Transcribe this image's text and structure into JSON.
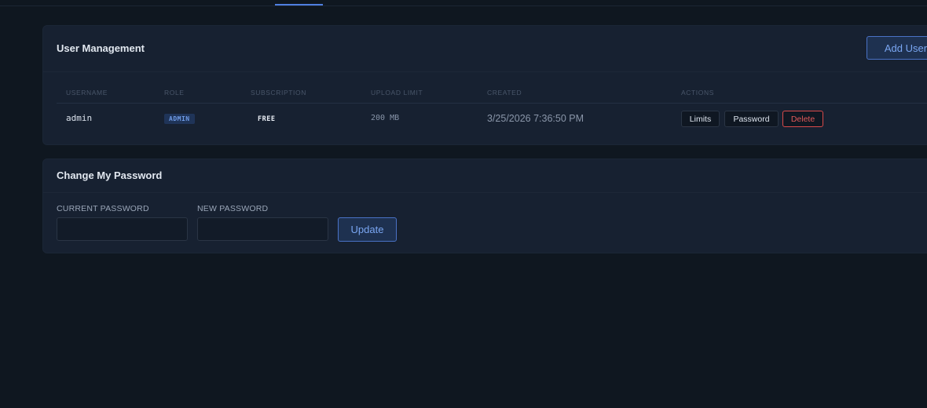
{
  "user_management": {
    "title": "User Management",
    "add_user_label": "Add User",
    "columns": [
      "USERNAME",
      "ROLE",
      "SUBSCRIPTION",
      "UPLOAD LIMIT",
      "CREATED",
      "ACTIONS"
    ],
    "rows": [
      {
        "username": "admin",
        "role": "ADMIN",
        "subscription": "FREE",
        "upload_limit": "200 MB",
        "created": "3/25/2026 7:36:50 PM",
        "actions": {
          "limits": "Limits",
          "password": "Password",
          "delete": "Delete"
        }
      }
    ]
  },
  "change_password": {
    "title": "Change My Password",
    "current_label": "CURRENT PASSWORD",
    "current_value": "",
    "new_label": "NEW PASSWORD",
    "new_value": "",
    "update_label": "Update"
  },
  "colors": {
    "background": "#0f1720",
    "card": "#172131",
    "accent": "#4f7fe0",
    "danger": "#e25a5a"
  }
}
